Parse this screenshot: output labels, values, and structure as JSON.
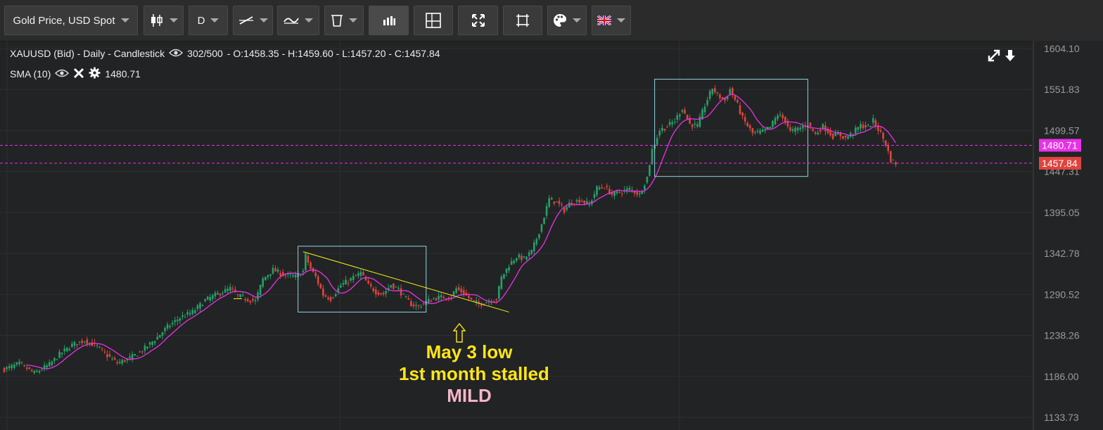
{
  "toolbar": {
    "instrument": "Gold Price, USD Spot",
    "timeframe": "D",
    "buttons": [
      "candlestick-icon",
      "timeframe-select",
      "line-tool-icon",
      "indicators-icon",
      "trash-icon",
      "volume-icon",
      "layout-icon",
      "fullscreen-icon",
      "fit-icon",
      "palette-icon",
      "language-flag-icon"
    ]
  },
  "legend": {
    "instrument_line": "XAUUSD (Bid) - Daily - Candlestick",
    "bars": "302/500",
    "ohlc": "- O:1458.35 - H:1459.60 - L:1457.20 - C:1457.84",
    "sma_label": "SMA (10)",
    "sma_value": "1480.71"
  },
  "annotations": {
    "line1": "May 3 low",
    "line2": "1st month stalled",
    "line3": "MILD"
  },
  "colors": {
    "up": "#27a069",
    "down": "#e0443e",
    "sma": "#e832e8",
    "trendline": "#f2f21a",
    "box": "#8fd4e0",
    "annotation": "#ffe61a",
    "mild": "#f5b6c8"
  },
  "chart_data": {
    "type": "candlestick",
    "y_axis_ticks": [
      "1604.10",
      "1551.83",
      "1499.57",
      "1447.31",
      "1395.05",
      "1342.78",
      "1290.52",
      "1238.26",
      "1186.00",
      "1133.73"
    ],
    "ylim": [
      1133.73,
      1604.1
    ],
    "price_tags": [
      {
        "label": "1480.71",
        "color": "#e832e8",
        "value": 1480.71
      },
      {
        "label": "1457.84",
        "color": "#e0443e",
        "value": 1457.84
      }
    ],
    "close_path": [
      [
        0,
        1195
      ],
      [
        6,
        1202
      ],
      [
        12,
        1190
      ],
      [
        18,
        1201
      ],
      [
        22,
        1214
      ],
      [
        27,
        1226
      ],
      [
        32,
        1232
      ],
      [
        37,
        1224
      ],
      [
        40,
        1215
      ],
      [
        45,
        1203
      ],
      [
        50,
        1209
      ],
      [
        55,
        1219
      ],
      [
        60,
        1233
      ],
      [
        65,
        1249
      ],
      [
        70,
        1261
      ],
      [
        75,
        1268
      ],
      [
        80,
        1283
      ],
      [
        85,
        1291
      ],
      [
        90,
        1298
      ],
      [
        93,
        1289
      ],
      [
        96,
        1285
      ],
      [
        100,
        1282
      ],
      [
        103,
        1310
      ],
      [
        107,
        1322
      ],
      [
        111,
        1316
      ],
      [
        116,
        1313
      ],
      [
        119,
        1320
      ],
      [
        120,
        1340
      ],
      [
        122,
        1323
      ],
      [
        124,
        1313
      ],
      [
        127,
        1290
      ],
      [
        130,
        1285
      ],
      [
        134,
        1302
      ],
      [
        138,
        1310
      ],
      [
        142,
        1318
      ],
      [
        145,
        1302
      ],
      [
        148,
        1294
      ],
      [
        151,
        1291
      ],
      [
        154,
        1303
      ],
      [
        157,
        1297
      ],
      [
        159,
        1288
      ],
      [
        162,
        1278
      ],
      [
        165,
        1275
      ],
      [
        168,
        1281
      ],
      [
        172,
        1286
      ],
      [
        175,
        1287
      ],
      [
        178,
        1288
      ],
      [
        180,
        1298
      ],
      [
        183,
        1292
      ],
      [
        186,
        1283
      ],
      [
        189,
        1278
      ],
      [
        192,
        1281
      ],
      [
        196,
        1285
      ],
      [
        198,
        1312
      ],
      [
        201,
        1328
      ],
      [
        204,
        1339
      ],
      [
        207,
        1336
      ],
      [
        210,
        1345
      ],
      [
        212,
        1362
      ],
      [
        214,
        1380
      ],
      [
        217,
        1412
      ],
      [
        220,
        1408
      ],
      [
        223,
        1398
      ],
      [
        225,
        1406
      ],
      [
        229,
        1411
      ],
      [
        233,
        1405
      ],
      [
        236,
        1426
      ],
      [
        239,
        1428
      ],
      [
        242,
        1418
      ],
      [
        246,
        1422
      ],
      [
        249,
        1425
      ],
      [
        253,
        1418
      ],
      [
        256,
        1440
      ],
      [
        258,
        1475
      ],
      [
        261,
        1500
      ],
      [
        264,
        1505
      ],
      [
        267,
        1512
      ],
      [
        270,
        1528
      ],
      [
        273,
        1508
      ],
      [
        276,
        1505
      ],
      [
        279,
        1532
      ],
      [
        282,
        1554
      ],
      [
        284,
        1545
      ],
      [
        287,
        1538
      ],
      [
        289,
        1552
      ],
      [
        292,
        1532
      ],
      [
        294,
        1515
      ],
      [
        298,
        1496
      ],
      [
        302,
        1498
      ],
      [
        305,
        1504
      ],
      [
        308,
        1520
      ],
      [
        311,
        1513
      ],
      [
        313,
        1498
      ],
      [
        317,
        1503
      ],
      [
        320,
        1508
      ],
      [
        323,
        1495
      ],
      [
        326,
        1505
      ],
      [
        330,
        1492
      ],
      [
        332,
        1495
      ],
      [
        335,
        1490
      ],
      [
        338,
        1497
      ],
      [
        341,
        1506
      ],
      [
        344,
        1504
      ],
      [
        346,
        1512
      ],
      [
        349,
        1496
      ],
      [
        351,
        1482
      ],
      [
        353,
        1462
      ],
      [
        355,
        1458
      ]
    ],
    "trendline": {
      "from": [
        119,
        1345
      ],
      "to": [
        201,
        1268
      ]
    },
    "boxes": [
      {
        "x_from": 117,
        "x_to": 168,
        "y_from": 1268,
        "y_to": 1352
      },
      {
        "x_from": 259,
        "x_to": 320,
        "y_from": 1441,
        "y_to": 1565
      }
    ],
    "support_marker": [
      93,
      1285
    ]
  }
}
